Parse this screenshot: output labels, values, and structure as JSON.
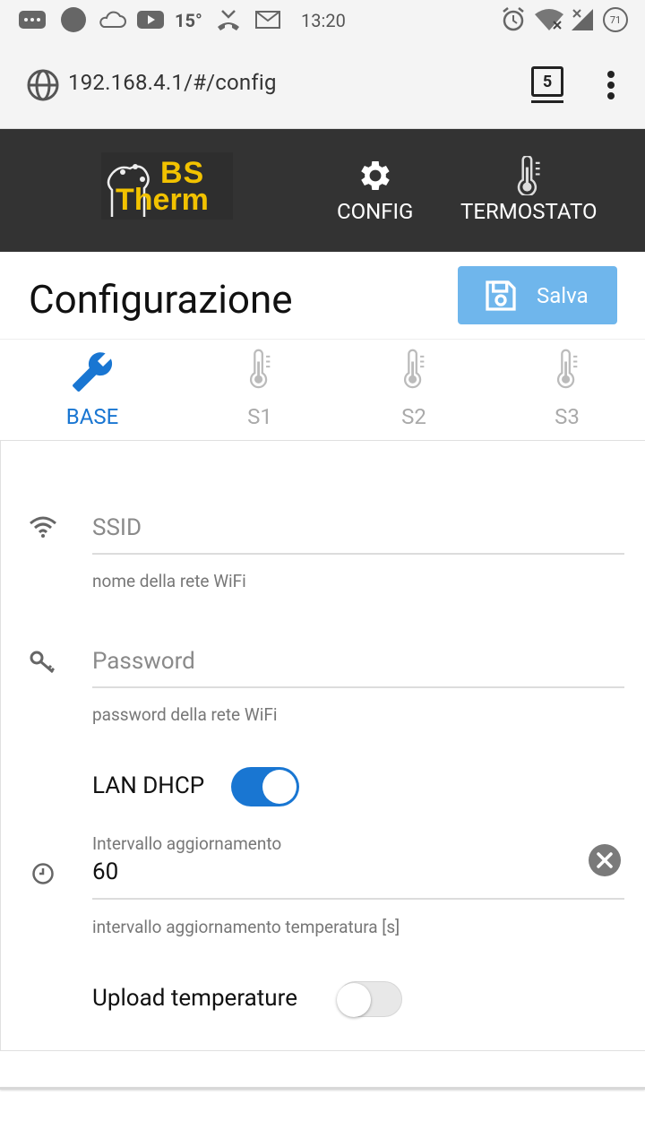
{
  "status_bar": {
    "temperature": "15°",
    "time": "13:20",
    "battery": "71"
  },
  "browser": {
    "url": "192.168.4.1/#/config",
    "tab_count": "5"
  },
  "header": {
    "logo_line1": "BS",
    "logo_line2": "Therm",
    "nav": [
      {
        "label": "CONFIG",
        "icon": "gear-icon"
      },
      {
        "label": "TERMOSTATO",
        "icon": "thermometer-icon"
      }
    ]
  },
  "page": {
    "title": "Configurazione",
    "save_label": "Salva"
  },
  "tabs": [
    {
      "label": "BASE",
      "icon": "wrench-icon",
      "active": true
    },
    {
      "label": "S1",
      "icon": "thermometer-icon",
      "active": false
    },
    {
      "label": "S2",
      "icon": "thermometer-icon",
      "active": false
    },
    {
      "label": "S3",
      "icon": "thermometer-icon",
      "active": false
    }
  ],
  "form": {
    "ssid": {
      "placeholder": "SSID",
      "hint": "nome della rete WiFi"
    },
    "password": {
      "placeholder": "Password",
      "hint": "password della rete WiFi"
    },
    "lan_dhcp": {
      "label": "LAN DHCP",
      "checked": true
    },
    "interval": {
      "label": "Intervallo aggiornamento",
      "value": "60",
      "hint": "intervallo aggiornamento temperatura [s]"
    },
    "upload": {
      "label": "Upload temperature",
      "checked": false
    }
  },
  "colors": {
    "header_bg": "#333333",
    "accent": "#1976d2",
    "save_bg": "#6fb6ec",
    "logo_yellow": "#f2c200"
  }
}
